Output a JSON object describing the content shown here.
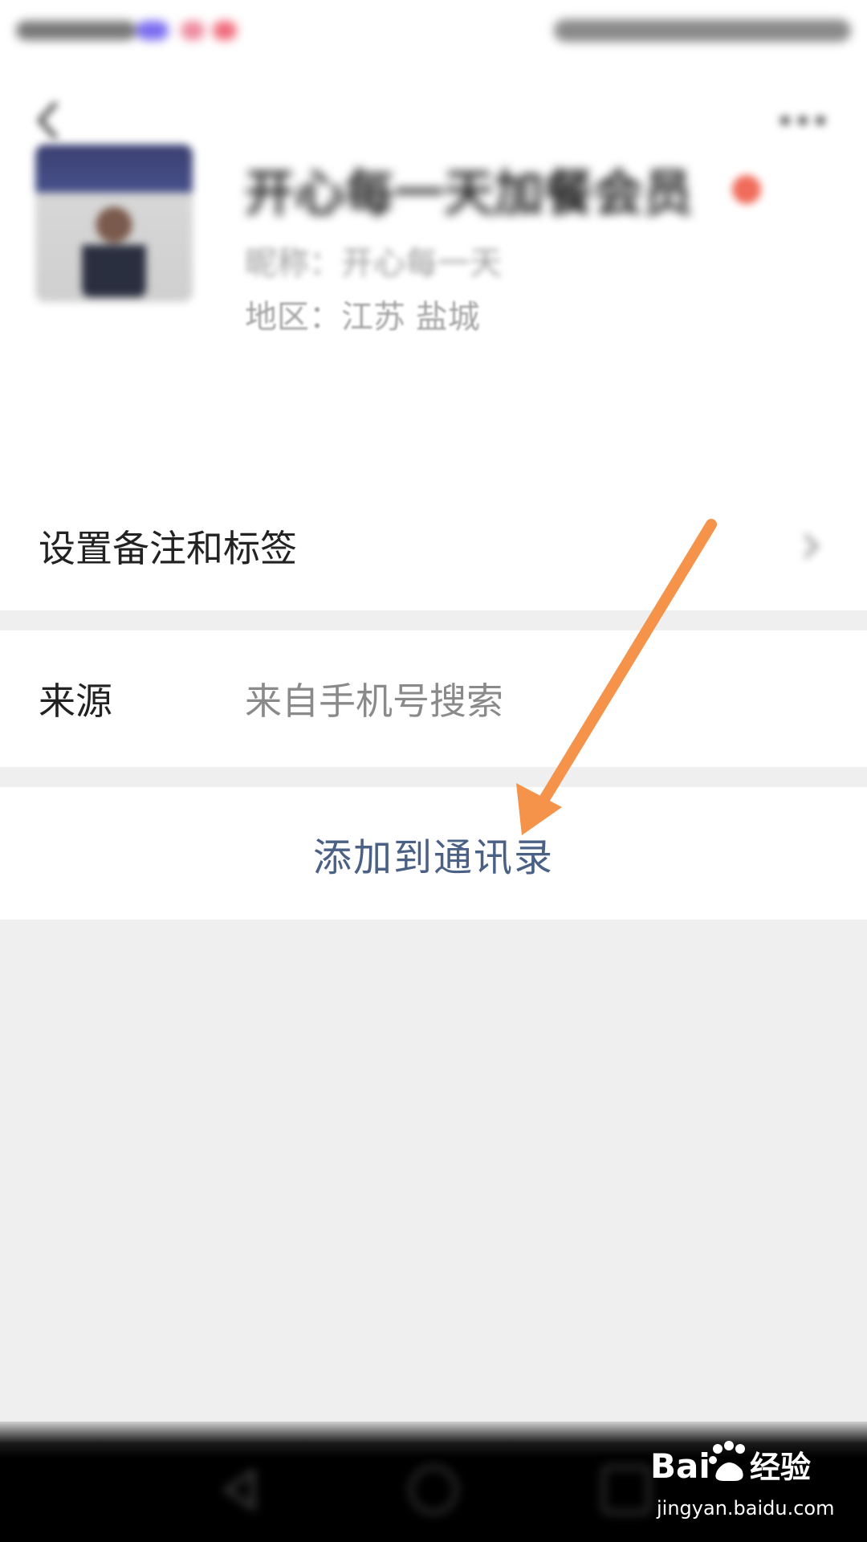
{
  "profile": {
    "name": "开心每一天加餐会员",
    "nickname": "昵称：开心每一天",
    "region": "地区：江苏  盐城"
  },
  "rows": {
    "remark_label": "设置备注和标签",
    "source_label": "来源",
    "source_value": "来自手机号搜索",
    "add_contact": "添加到通讯录"
  },
  "watermark": {
    "brand": "Baidu经验",
    "url": "jingyan.baidu.com"
  },
  "colors": {
    "accent_link": "#4a6085",
    "annotation_arrow": "#f5934a",
    "page_background": "#efefef"
  }
}
